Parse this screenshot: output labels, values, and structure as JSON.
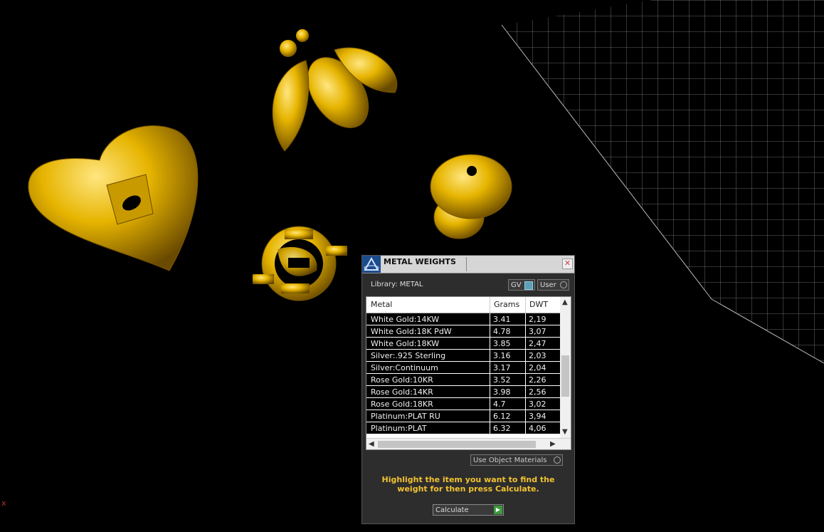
{
  "viewport": {
    "axis_label": "x"
  },
  "panel": {
    "title": "METAL WEIGHTS",
    "close_icon": "close-icon",
    "library_label": "Library: METAL",
    "gv_label": "GV",
    "user_label": "User",
    "table": {
      "headers": [
        "Metal",
        "Grams",
        "DWT"
      ],
      "rows": [
        {
          "metal": "White Gold:14KW",
          "grams": "3.41",
          "dwt": "2,19"
        },
        {
          "metal": "White Gold:18K PdW",
          "grams": "4.78",
          "dwt": "3,07"
        },
        {
          "metal": "White Gold:18KW",
          "grams": "3.85",
          "dwt": "2,47"
        },
        {
          "metal": "Silver:.925 Sterling",
          "grams": "3.16",
          "dwt": "2,03"
        },
        {
          "metal": "Silver:Continuum",
          "grams": "3.17",
          "dwt": "2,04"
        },
        {
          "metal": "Rose Gold:10KR",
          "grams": "3.52",
          "dwt": "2,26"
        },
        {
          "metal": "Rose Gold:14KR",
          "grams": "3.98",
          "dwt": "2,56"
        },
        {
          "metal": "Rose Gold:18KR",
          "grams": "4.7",
          "dwt": "3,02"
        },
        {
          "metal": "Platinum:PLAT RU",
          "grams": "6.12",
          "dwt": "3,94"
        },
        {
          "metal": "Platinum:PLAT",
          "grams": "6.32",
          "dwt": "4,06"
        }
      ]
    },
    "use_object_materials": "Use Object Materials",
    "instructions": "Highlight the item you want to find the weight for then press Calculate.",
    "calculate_label": "Calculate"
  },
  "colors": {
    "gold": "#e6b400",
    "accent_text": "#f2c230",
    "background": "#000000"
  }
}
